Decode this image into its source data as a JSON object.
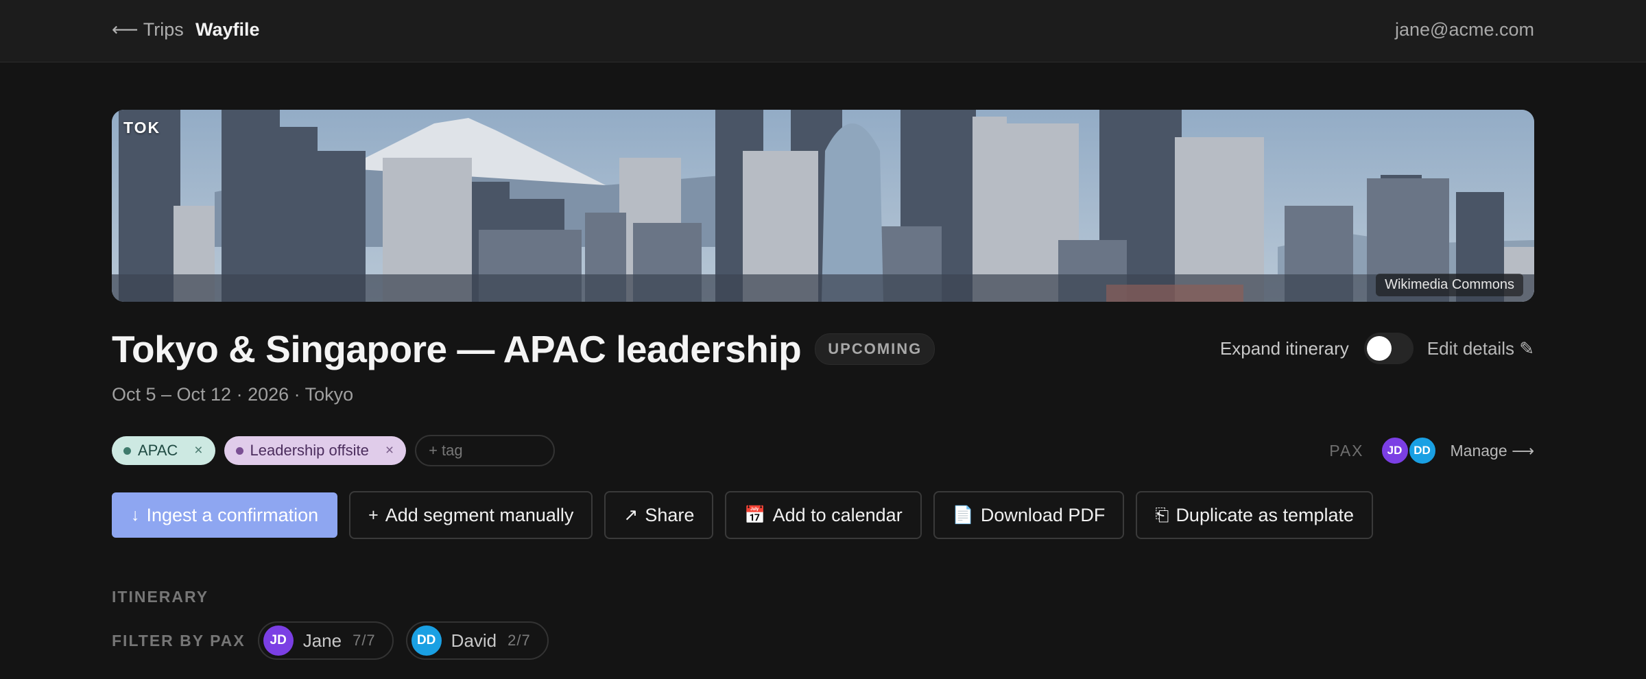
{
  "topbar": {
    "back_label": "⟵ Trips",
    "brand": "Wayfile",
    "user_email": "jane@acme.com"
  },
  "hero": {
    "city_code": "TOK",
    "credit": "Wikimedia Commons"
  },
  "trip": {
    "title": "Tokyo & Singapore — APAC leadership",
    "status": "UPCOMING",
    "subtitle": "Oct 5 – Oct 12 · 2026 · Tokyo"
  },
  "controls": {
    "expand_label": "Expand itinerary",
    "expand_on": false,
    "edit_label": "Edit details ✎"
  },
  "tags": {
    "items": [
      {
        "label": "APAC",
        "remove": "×"
      },
      {
        "label": "Leadership offsite",
        "remove": "×"
      }
    ],
    "input_placeholder": "+ tag"
  },
  "pax": {
    "label": "PAX",
    "avatars": [
      "JD",
      "DD"
    ],
    "manage_label": "Manage ⟶"
  },
  "actions": [
    {
      "icon": "↓",
      "label": "Ingest a confirmation"
    },
    {
      "icon": "+",
      "label": "Add segment manually"
    },
    {
      "icon": "↗",
      "label": "Share"
    },
    {
      "icon": "📅",
      "label": "Add to calendar"
    },
    {
      "icon": "📄",
      "label": "Download PDF"
    },
    {
      "icon": "⎗",
      "label": "Duplicate as template"
    }
  ],
  "itinerary": {
    "section_label": "ITINERARY",
    "filter_label": "FILTER BY PAX",
    "filters": [
      {
        "initials": "JD",
        "name": "Jane",
        "count": "7/7"
      },
      {
        "initials": "DD",
        "name": "David",
        "count": "2/7"
      }
    ]
  },
  "colors": {
    "background": "#141414",
    "primary_button": "#8ea6f1",
    "avatar_jd": "#7b3fe4",
    "avatar_dd": "#1aa0e3",
    "tag_apac": "#cde9e2",
    "tag_leadership": "#e0ccea"
  }
}
